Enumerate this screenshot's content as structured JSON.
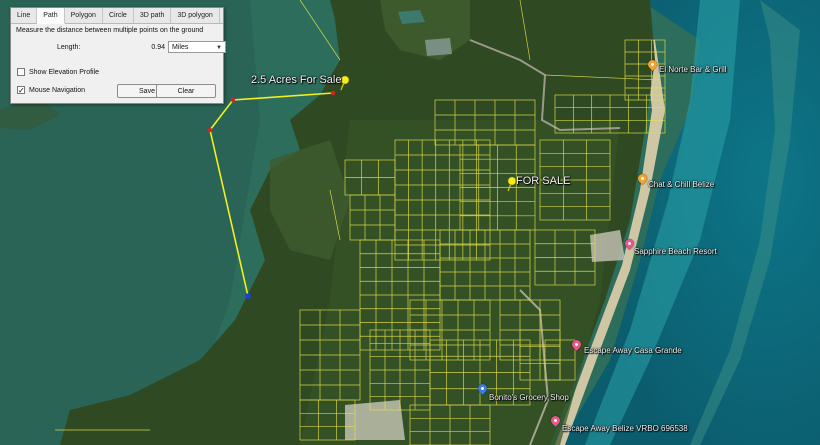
{
  "dialog": {
    "tabs": [
      {
        "label": "Line",
        "active": false
      },
      {
        "label": "Path",
        "active": true
      },
      {
        "label": "Polygon",
        "active": false
      },
      {
        "label": "Circle",
        "active": false
      },
      {
        "label": "3D path",
        "active": false
      },
      {
        "label": "3D polygon",
        "active": false
      }
    ],
    "description": "Measure the distance between multiple points on the ground",
    "length_label": "Length:",
    "length_value": "0.94",
    "unit": "Miles",
    "show_elevation_label": "Show Elevation Profile",
    "show_elevation_checked": false,
    "mouse_nav_label": "Mouse Navigation",
    "mouse_nav_checked": true,
    "save_label": "Save",
    "clear_label": "Clear"
  },
  "map": {
    "placemarks": [
      {
        "label": "2.5 Acres For Sale"
      },
      {
        "label": "FOR SALE"
      }
    ],
    "pois": [
      {
        "label": "El Norte Bar & Grill",
        "color": "#f2a22e"
      },
      {
        "label": "Chat & Chill Belize",
        "color": "#f2a22e"
      },
      {
        "label": "Sapphire Beach Resort",
        "color": "#e8578a"
      },
      {
        "label": "Escape Away Casa Grande",
        "color": "#e8578a"
      },
      {
        "label": "Bonito's Grocery Shop",
        "color": "#3c7be0"
      },
      {
        "label": "Escape Away Belize VRBO 696538",
        "color": "#e8578a"
      }
    ],
    "colors": {
      "lagoon": "#2c6d5b",
      "land": "#2f4a22",
      "sea": "#0e7f8c",
      "parcel_lines": "#e7e24a",
      "path_line": "#f3f01f",
      "path_vertex": "#e02020",
      "path_end": "#1d3fe0"
    }
  }
}
